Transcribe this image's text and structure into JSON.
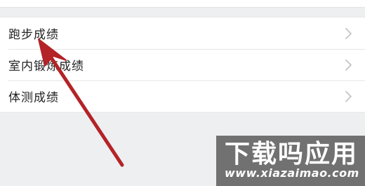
{
  "menu": {
    "items": [
      {
        "label": "跑步成绩"
      },
      {
        "label": "室内锻炼成绩"
      },
      {
        "label": "体测成绩"
      }
    ]
  },
  "watermark": {
    "brand": "下载吗应用",
    "url": "www.xiazaimao.com"
  },
  "colors": {
    "background": "#eeeff1",
    "item_background": "#ffffff",
    "text": "#222222",
    "chevron": "#c4c4c4",
    "arrow": "#b42327"
  },
  "icons": {
    "row_chevron": "chevron-right-icon",
    "annotation": "red-pointer-arrow"
  }
}
